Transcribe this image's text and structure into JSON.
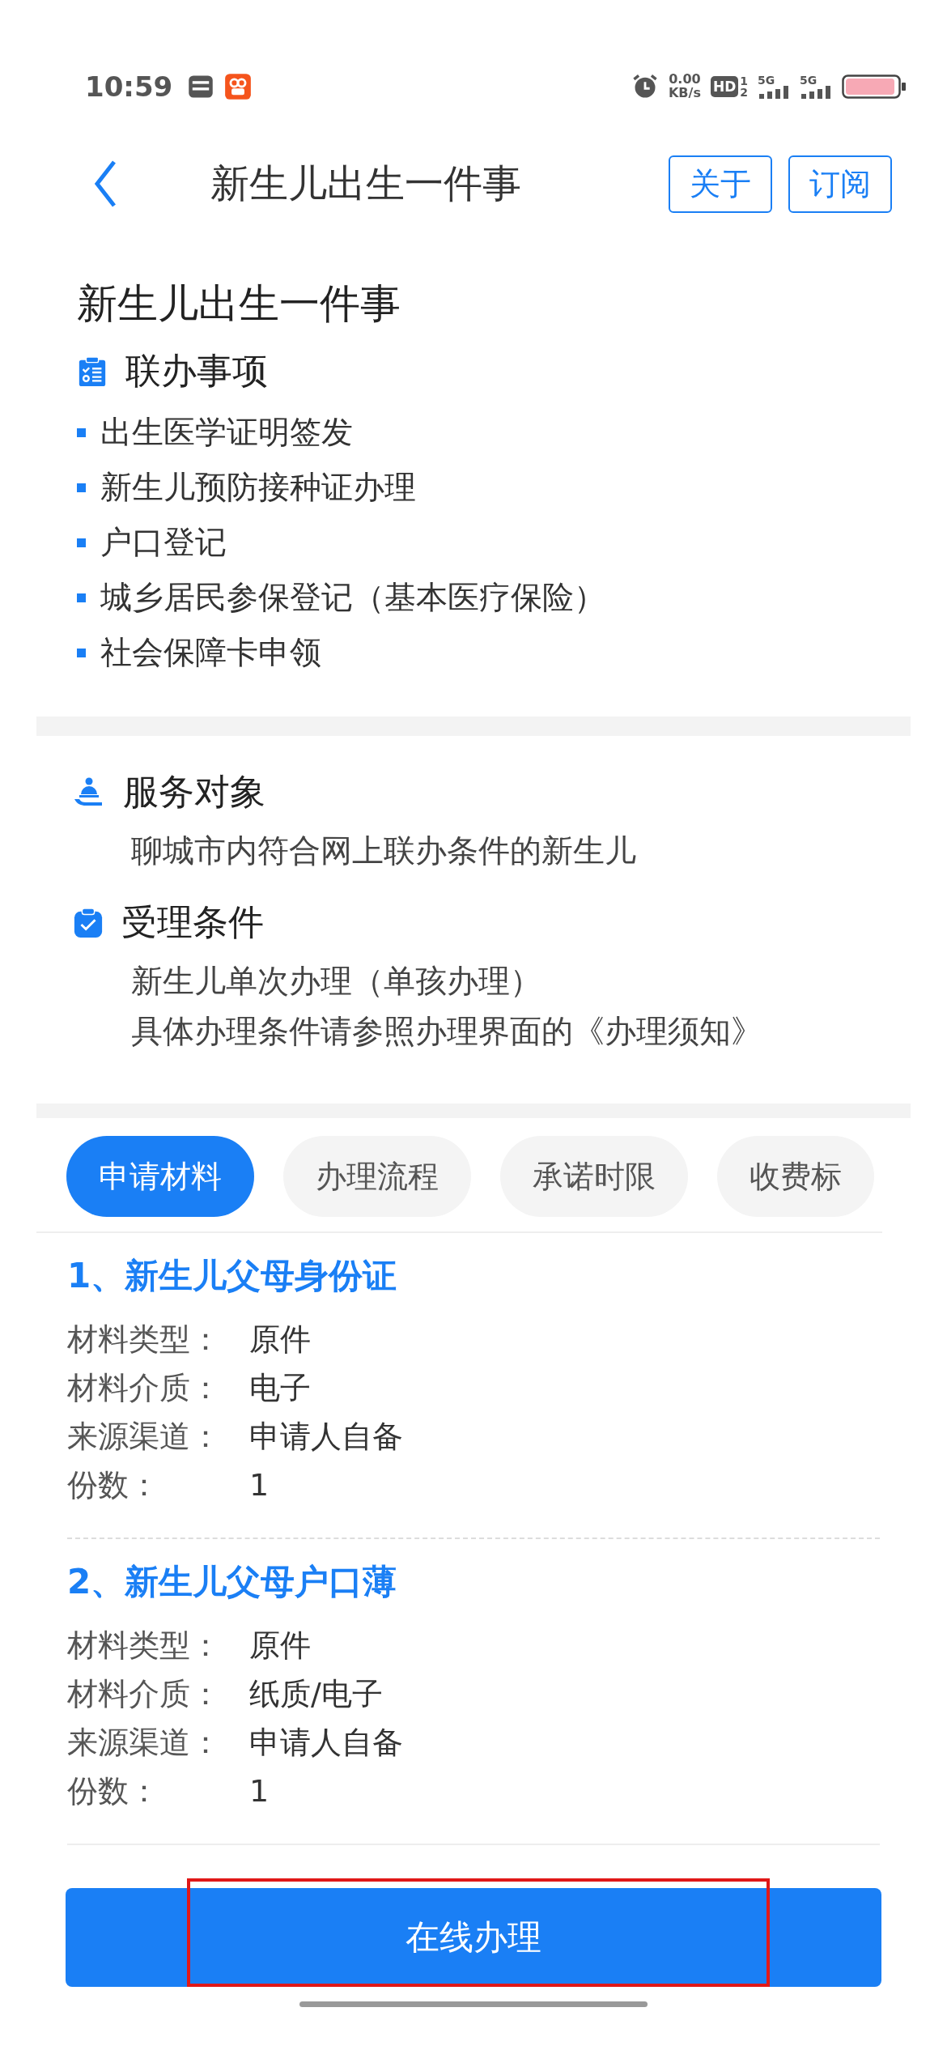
{
  "status_bar": {
    "time": "10:59",
    "speed": "0.00",
    "speed_unit": "KB/s",
    "hd": "HD",
    "sim_1": "1",
    "sim_2": "2",
    "network_1": "5G",
    "network_2": "5G"
  },
  "header": {
    "title": "新生儿出生一件事",
    "actions": [
      "关于",
      "订阅"
    ]
  },
  "summary": {
    "title": "新生儿出生一件事",
    "heading": "联办事项",
    "items": [
      "出生医学证明签发",
      "新生儿预防接种证办理",
      "户口登记",
      "城乡居民参保登记（基本医疗保险）",
      "社会保障卡申领"
    ]
  },
  "info": [
    {
      "kind": "people",
      "heading": "服务对象",
      "lines": [
        "聊城市内符合网上联办条件的新生儿"
      ]
    },
    {
      "kind": "check",
      "heading": "受理条件",
      "lines": [
        "新生儿单次办理（单孩办理）",
        "具体办理条件请参照办理界面的《办理须知》"
      ]
    }
  ],
  "tabs": [
    {
      "label": "申请材料",
      "selected": true
    },
    {
      "label": "办理流程",
      "selected": false
    },
    {
      "label": "承诺时限",
      "selected": false
    },
    {
      "label": "收费标",
      "selected": false
    }
  ],
  "materials": [
    {
      "title": "1、新生儿父母身份证",
      "fields": [
        {
          "label": "材料类型：",
          "value": "原件"
        },
        {
          "label": "材料介质：",
          "value": "电子"
        },
        {
          "label": "来源渠道：",
          "value": "申请人自备"
        },
        {
          "label": "份数：",
          "value": "1"
        }
      ]
    },
    {
      "title": "2、新生儿父母户口薄",
      "fields": [
        {
          "label": "材料类型：",
          "value": "原件"
        },
        {
          "label": "材料介质：",
          "value": "纸质/电子"
        },
        {
          "label": "来源渠道：",
          "value": "申请人自备"
        },
        {
          "label": "份数：",
          "value": "1"
        }
      ]
    }
  ],
  "primary_button": {
    "label": "在线办理",
    "highlighted": true
  }
}
